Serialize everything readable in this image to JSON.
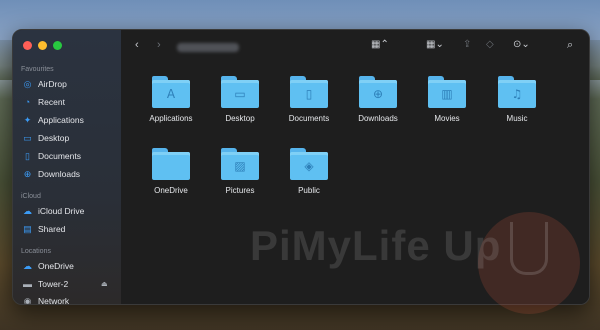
{
  "toolbar": {
    "back_icon": "chevron-left-icon",
    "forward_icon": "chevron-right-icon",
    "view_icon": "grid-icon",
    "group_icon": "group-grid-icon",
    "share_icon": "share-icon",
    "tag_icon": "tag-icon",
    "more_icon": "ellipsis-icon",
    "search_icon": "search-icon"
  },
  "sidebar": {
    "favourites_heading": "Favourites",
    "favourites": [
      {
        "label": "AirDrop",
        "icon": "airdrop-icon"
      },
      {
        "label": "Recent",
        "icon": "clock-icon"
      },
      {
        "label": "Applications",
        "icon": "applications-icon"
      },
      {
        "label": "Desktop",
        "icon": "desktop-icon"
      },
      {
        "label": "Documents",
        "icon": "document-icon"
      },
      {
        "label": "Downloads",
        "icon": "download-icon"
      }
    ],
    "icloud_heading": "iCloud",
    "icloud": [
      {
        "label": "iCloud Drive",
        "icon": "cloud-icon"
      },
      {
        "label": "Shared",
        "icon": "shared-folder-icon"
      }
    ],
    "locations_heading": "Locations",
    "locations": [
      {
        "label": "OneDrive",
        "icon": "cloud-icon"
      },
      {
        "label": "Tower-2",
        "icon": "drive-icon"
      },
      {
        "label": "Network",
        "icon": "globe-icon"
      }
    ]
  },
  "folders": [
    {
      "label": "Applications",
      "icon": "applications-icon"
    },
    {
      "label": "Desktop",
      "icon": "desktop-icon"
    },
    {
      "label": "Documents",
      "icon": "document-icon"
    },
    {
      "label": "Downloads",
      "icon": "download-icon"
    },
    {
      "label": "Movies",
      "icon": "film-icon"
    },
    {
      "label": "Music",
      "icon": "music-icon"
    },
    {
      "label": "OneDrive",
      "icon": "folder-icon"
    },
    {
      "label": "Pictures",
      "icon": "picture-icon"
    },
    {
      "label": "Public",
      "icon": "public-icon"
    }
  ],
  "watermark": {
    "text": "PiMyLife Up"
  },
  "colors": {
    "accent": "#3b9bf5",
    "folder": "#5fc0f2"
  }
}
